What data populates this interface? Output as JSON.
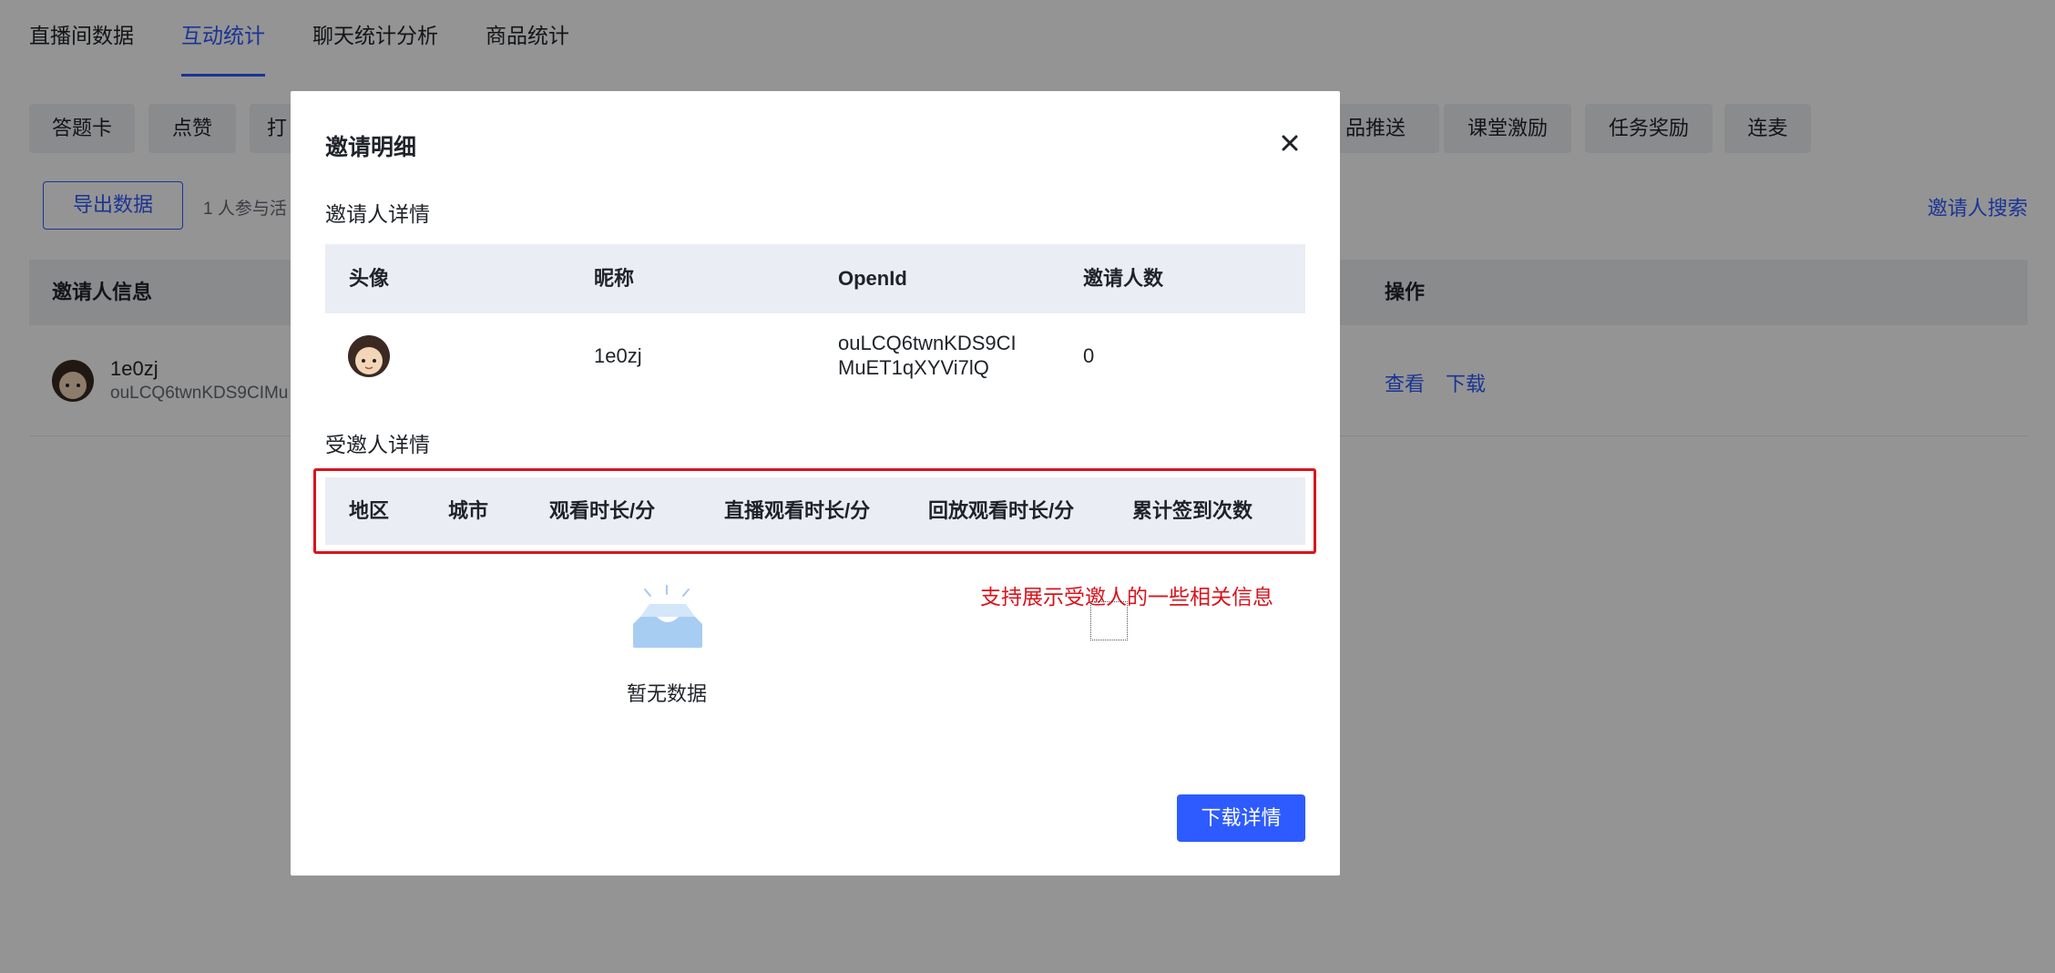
{
  "main_tabs": [
    {
      "label": "直播间数据"
    },
    {
      "label": "互动统计"
    },
    {
      "label": "聊天统计分析"
    },
    {
      "label": "商品统计"
    }
  ],
  "sub_tabs": [
    {
      "label": "答题卡"
    },
    {
      "label": "点赞"
    },
    {
      "label": "打"
    },
    {
      "label": "品推送"
    },
    {
      "label": "课堂激励"
    },
    {
      "label": "任务奖励"
    },
    {
      "label": "连麦"
    }
  ],
  "toolbar": {
    "export_label": "导出数据",
    "participants_text": "1 人参与活",
    "search_link": "邀请人搜索"
  },
  "bg_table": {
    "headers": {
      "inviter_info": "邀请人信息",
      "actions": "操作"
    },
    "row": {
      "nickname": "1e0zj",
      "openid": "ouLCQ6twnKDS9CIMu",
      "view_label": "查看",
      "download_label": "下载"
    }
  },
  "modal": {
    "title": "邀请明细",
    "inviter_section_title": "邀请人详情",
    "inviter_table": {
      "headers": {
        "avatar": "头像",
        "nickname": "昵称",
        "openid": "OpenId",
        "invite_count": "邀请人数"
      },
      "row": {
        "nickname": "1e0zj",
        "openid_line1": "ouLCQ6twnKDS9CI",
        "openid_line2": "MuET1qXYVi7lQ",
        "invite_count": "0"
      }
    },
    "invitee_section_title": "受邀人详情",
    "invitee_table": {
      "headers": {
        "region": "地区",
        "city": "城市",
        "watch_time": "观看时长/分",
        "live_watch_time": "直播观看时长/分",
        "replay_watch_time": "回放观看时长/分",
        "checkin_count": "累计签到次数"
      }
    },
    "empty_text": "暂无数据",
    "annotation": "支持展示受邀人的一些相关信息",
    "download_label": "下载详情"
  },
  "colors": {
    "accent": "#2e5bff",
    "annotation_red": "#d9141d",
    "table_header_bg": "#eaeef4"
  },
  "icons": {
    "close": "close-icon",
    "empty": "empty-box-icon",
    "avatar": "avatar"
  }
}
